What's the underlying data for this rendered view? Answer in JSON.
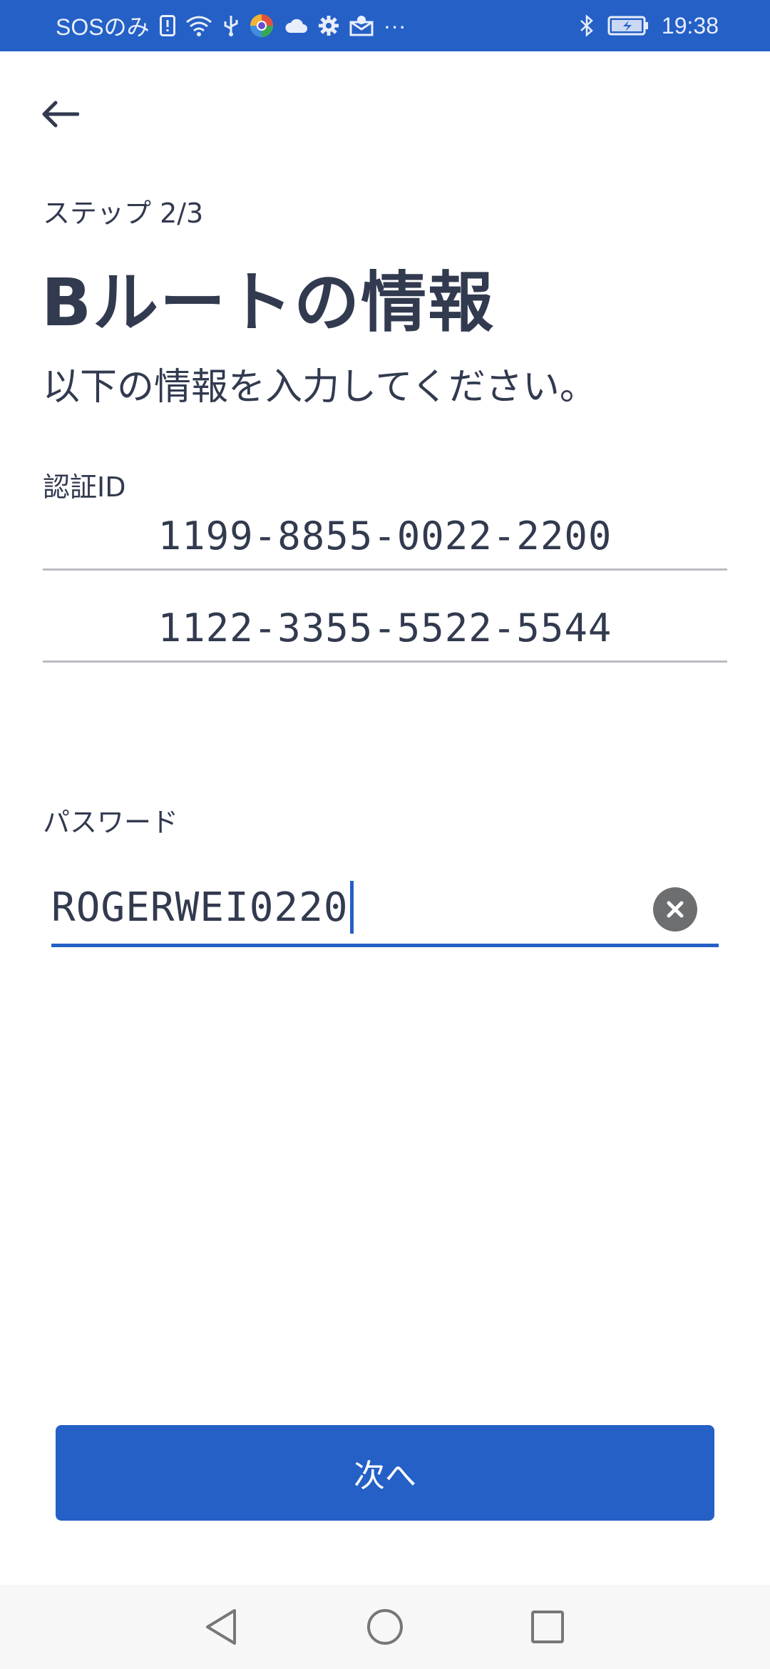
{
  "status_bar": {
    "carrier": "SOSのみ",
    "more": "···",
    "time": "19:38"
  },
  "step_label": "ステップ 2/3",
  "title": "Bルートの情報",
  "subtitle": "以下の情報を入力してください。",
  "auth_id": {
    "label": "認証ID",
    "values": [
      "1199-8855-0022-2200",
      "1122-3355-5522-5544"
    ]
  },
  "password": {
    "label": "パスワード",
    "value": "ROGERWEI0220"
  },
  "next_button": "次へ",
  "colors": {
    "accent": "#2460c6",
    "text": "#323a4f",
    "divider": "#b9bcc4",
    "clear": "#6d6e70"
  }
}
